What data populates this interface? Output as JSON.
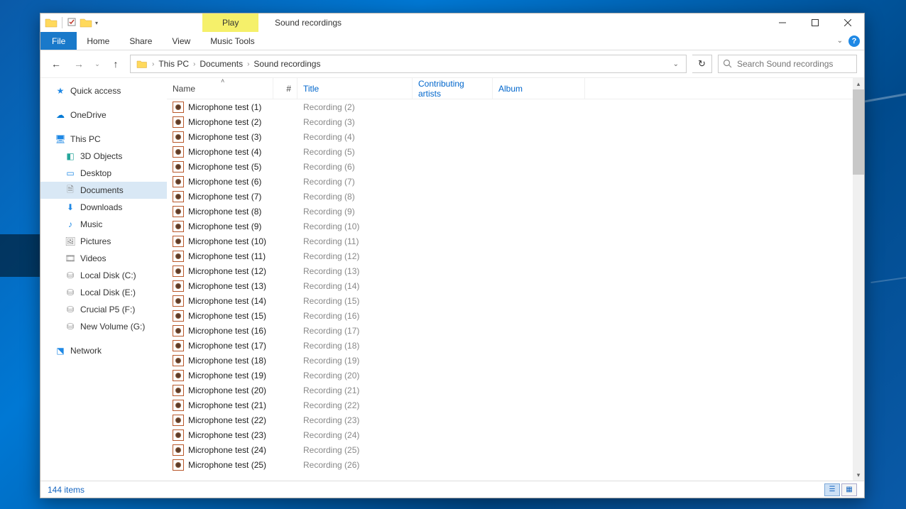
{
  "title_context": "Play",
  "window_title": "Sound recordings",
  "ribbon": {
    "file": "File",
    "home": "Home",
    "share": "Share",
    "view": "View",
    "music_tools": "Music Tools"
  },
  "breadcrumb": {
    "root": "This PC",
    "p1": "Documents",
    "p2": "Sound recordings"
  },
  "search": {
    "placeholder": "Search Sound recordings"
  },
  "nav": {
    "quick_access": "Quick access",
    "onedrive": "OneDrive",
    "this_pc": "This PC",
    "objects3d": "3D Objects",
    "desktop": "Desktop",
    "documents": "Documents",
    "downloads": "Downloads",
    "music": "Music",
    "pictures": "Pictures",
    "videos": "Videos",
    "disk_c": "Local Disk (C:)",
    "disk_e": "Local Disk (E:)",
    "disk_f": "Crucial P5 (F:)",
    "disk_g": "New Volume (G:)",
    "network": "Network"
  },
  "columns": {
    "name": "Name",
    "num": "#",
    "title": "Title",
    "artists": "Contributing artists",
    "album": "Album"
  },
  "files": [
    {
      "name": "Microphone test (1)",
      "title": "Recording (2)"
    },
    {
      "name": "Microphone test (2)",
      "title": "Recording (3)"
    },
    {
      "name": "Microphone test (3)",
      "title": "Recording (4)"
    },
    {
      "name": "Microphone test (4)",
      "title": "Recording (5)"
    },
    {
      "name": "Microphone test (5)",
      "title": "Recording (6)"
    },
    {
      "name": "Microphone test (6)",
      "title": "Recording (7)"
    },
    {
      "name": "Microphone test (7)",
      "title": "Recording (8)"
    },
    {
      "name": "Microphone test (8)",
      "title": "Recording (9)"
    },
    {
      "name": "Microphone test (9)",
      "title": "Recording (10)"
    },
    {
      "name": "Microphone test (10)",
      "title": "Recording (11)"
    },
    {
      "name": "Microphone test (11)",
      "title": "Recording (12)"
    },
    {
      "name": "Microphone test (12)",
      "title": "Recording (13)"
    },
    {
      "name": "Microphone test (13)",
      "title": "Recording (14)"
    },
    {
      "name": "Microphone test (14)",
      "title": "Recording (15)"
    },
    {
      "name": "Microphone test (15)",
      "title": "Recording (16)"
    },
    {
      "name": "Microphone test (16)",
      "title": "Recording (17)"
    },
    {
      "name": "Microphone test (17)",
      "title": "Recording (18)"
    },
    {
      "name": "Microphone test (18)",
      "title": "Recording (19)"
    },
    {
      "name": "Microphone test (19)",
      "title": "Recording (20)"
    },
    {
      "name": "Microphone test (20)",
      "title": "Recording (21)"
    },
    {
      "name": "Microphone test (21)",
      "title": "Recording (22)"
    },
    {
      "name": "Microphone test (22)",
      "title": "Recording (23)"
    },
    {
      "name": "Microphone test (23)",
      "title": "Recording (24)"
    },
    {
      "name": "Microphone test (24)",
      "title": "Recording (25)"
    },
    {
      "name": "Microphone test (25)",
      "title": "Recording (26)"
    }
  ],
  "status": {
    "items": "144 items"
  }
}
